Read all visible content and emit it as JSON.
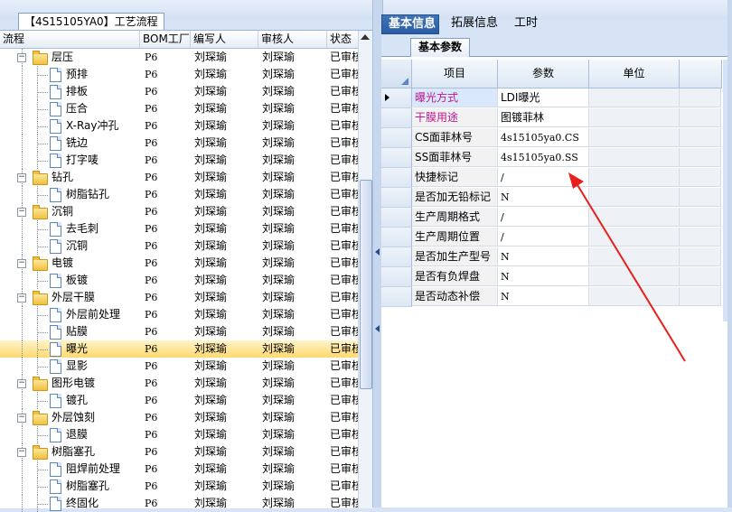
{
  "left_window_title": "【4S15105YA0】工艺流程",
  "left_headers": [
    "流程",
    "BOM工厂",
    "编写人",
    "审核人",
    "状态"
  ],
  "tree_rows": [
    {
      "label": "层压",
      "type": "folder",
      "level": 1,
      "factory": "P6",
      "author": "刘琛瑜",
      "reviewer": "刘琛瑜",
      "status": "已审核"
    },
    {
      "label": "预排",
      "type": "doc",
      "level": 2,
      "factory": "P6",
      "author": "刘琛瑜",
      "reviewer": "刘琛瑜",
      "status": "已审核"
    },
    {
      "label": "排板",
      "type": "doc",
      "level": 2,
      "factory": "P6",
      "author": "刘琛瑜",
      "reviewer": "刘琛瑜",
      "status": "已审核"
    },
    {
      "label": "压合",
      "type": "doc",
      "level": 2,
      "factory": "P6",
      "author": "刘琛瑜",
      "reviewer": "刘琛瑜",
      "status": "已审核"
    },
    {
      "label": "X-Ray冲孔",
      "type": "doc",
      "level": 2,
      "factory": "P6",
      "author": "刘琛瑜",
      "reviewer": "刘琛瑜",
      "status": "已审核"
    },
    {
      "label": "铣边",
      "type": "doc",
      "level": 2,
      "factory": "P6",
      "author": "刘琛瑜",
      "reviewer": "刘琛瑜",
      "status": "已审核"
    },
    {
      "label": "打字唛",
      "type": "doc",
      "level": 2,
      "factory": "P6",
      "author": "刘琛瑜",
      "reviewer": "刘琛瑜",
      "status": "已审核"
    },
    {
      "label": "钻孔",
      "type": "folder",
      "level": 1,
      "factory": "P6",
      "author": "刘琛瑜",
      "reviewer": "刘琛瑜",
      "status": "已审核"
    },
    {
      "label": "树脂钻孔",
      "type": "doc",
      "level": 2,
      "factory": "P6",
      "author": "刘琛瑜",
      "reviewer": "刘琛瑜",
      "status": "已审核"
    },
    {
      "label": "沉铜",
      "type": "folder",
      "level": 1,
      "factory": "P6",
      "author": "刘琛瑜",
      "reviewer": "刘琛瑜",
      "status": "已审核"
    },
    {
      "label": "去毛刺",
      "type": "doc",
      "level": 2,
      "factory": "P6",
      "author": "刘琛瑜",
      "reviewer": "刘琛瑜",
      "status": "已审核"
    },
    {
      "label": "沉铜",
      "type": "doc",
      "level": 2,
      "factory": "P6",
      "author": "刘琛瑜",
      "reviewer": "刘琛瑜",
      "status": "已审核"
    },
    {
      "label": "电镀",
      "type": "folder",
      "level": 1,
      "factory": "P6",
      "author": "刘琛瑜",
      "reviewer": "刘琛瑜",
      "status": "已审核"
    },
    {
      "label": "板镀",
      "type": "doc",
      "level": 2,
      "factory": "P6",
      "author": "刘琛瑜",
      "reviewer": "刘琛瑜",
      "status": "已审核"
    },
    {
      "label": "外层干膜",
      "type": "folder",
      "level": 1,
      "factory": "P6",
      "author": "刘琛瑜",
      "reviewer": "刘琛瑜",
      "status": "已审核"
    },
    {
      "label": "外层前处理",
      "type": "doc",
      "level": 2,
      "factory": "P6",
      "author": "刘琛瑜",
      "reviewer": "刘琛瑜",
      "status": "已审核"
    },
    {
      "label": "贴膜",
      "type": "doc",
      "level": 2,
      "factory": "P6",
      "author": "刘琛瑜",
      "reviewer": "刘琛瑜",
      "status": "已审核"
    },
    {
      "label": "曝光",
      "type": "doc",
      "level": 2,
      "factory": "P6",
      "author": "刘琛瑜",
      "reviewer": "刘琛瑜",
      "status": "已审核",
      "selected": true
    },
    {
      "label": "显影",
      "type": "doc",
      "level": 2,
      "factory": "P6",
      "author": "刘琛瑜",
      "reviewer": "刘琛瑜",
      "status": "已审核"
    },
    {
      "label": "图形电镀",
      "type": "folder",
      "level": 1,
      "factory": "P6",
      "author": "刘琛瑜",
      "reviewer": "刘琛瑜",
      "status": "已审核"
    },
    {
      "label": "镀孔",
      "type": "doc",
      "level": 2,
      "factory": "P6",
      "author": "刘琛瑜",
      "reviewer": "刘琛瑜",
      "status": "已审核"
    },
    {
      "label": "外层蚀刻",
      "type": "folder",
      "level": 1,
      "factory": "P6",
      "author": "刘琛瑜",
      "reviewer": "刘琛瑜",
      "status": "已审核"
    },
    {
      "label": "退膜",
      "type": "doc",
      "level": 2,
      "factory": "P6",
      "author": "刘琛瑜",
      "reviewer": "刘琛瑜",
      "status": "已审核"
    },
    {
      "label": "树脂塞孔",
      "type": "folder",
      "level": 1,
      "factory": "P6",
      "author": "刘琛瑜",
      "reviewer": "刘琛瑜",
      "status": "已审核"
    },
    {
      "label": "阻焊前处理",
      "type": "doc",
      "level": 2,
      "factory": "P6",
      "author": "刘琛瑜",
      "reviewer": "刘琛瑜",
      "status": "已审核"
    },
    {
      "label": "树脂塞孔",
      "type": "doc",
      "level": 2,
      "factory": "P6",
      "author": "刘琛瑜",
      "reviewer": "刘琛瑜",
      "status": "已审核"
    },
    {
      "label": "终固化",
      "type": "doc",
      "level": 2,
      "factory": "P6",
      "author": "刘琛瑜",
      "reviewer": "刘琛瑜",
      "status": "已审核"
    }
  ],
  "right_tabs": [
    "基本信息",
    "拓展信息",
    "工时"
  ],
  "active_tab": "基本信息",
  "sub_tab": "基本参数",
  "grid_headers": [
    "项目",
    "参数",
    "单位"
  ],
  "param_rows": [
    {
      "name": "曝光方式",
      "value": "LDI曝光",
      "unit": "",
      "magenta": true,
      "current": true
    },
    {
      "name": "干膜用途",
      "value": "图镀菲林",
      "unit": "",
      "magenta": true
    },
    {
      "name": "CS面菲林号",
      "value": "4s15105ya0.CS",
      "unit": ""
    },
    {
      "name": "SS面菲林号",
      "value": "4s15105ya0.SS",
      "unit": ""
    },
    {
      "name": "快捷标记",
      "value": "/",
      "unit": ""
    },
    {
      "name": "是否加无铅标记",
      "value": "N",
      "unit": ""
    },
    {
      "name": "生产周期格式",
      "value": "/",
      "unit": ""
    },
    {
      "name": "生产周期位置",
      "value": "/",
      "unit": ""
    },
    {
      "name": "是否加生产型号",
      "value": "N",
      "unit": ""
    },
    {
      "name": "是否有负焊盘",
      "value": "N",
      "unit": ""
    },
    {
      "name": "是否动态补偿",
      "value": "N",
      "unit": ""
    }
  ],
  "annotation_color": "#e8201c"
}
